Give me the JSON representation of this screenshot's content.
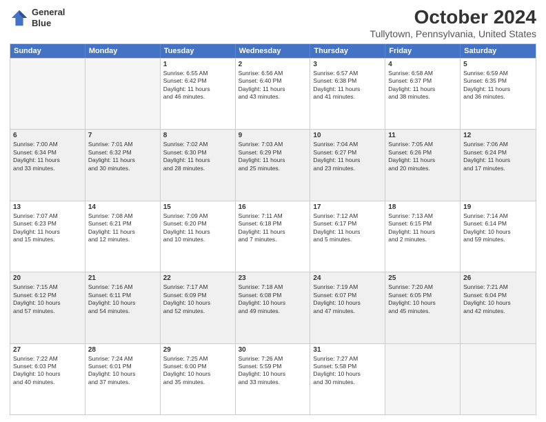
{
  "header": {
    "logo_line1": "General",
    "logo_line2": "Blue",
    "month": "October 2024",
    "location": "Tullytown, Pennsylvania, United States"
  },
  "weekdays": [
    "Sunday",
    "Monday",
    "Tuesday",
    "Wednesday",
    "Thursday",
    "Friday",
    "Saturday"
  ],
  "rows": [
    [
      {
        "day": "",
        "text": "",
        "empty": true
      },
      {
        "day": "",
        "text": "",
        "empty": true
      },
      {
        "day": "1",
        "text": "Sunrise: 6:55 AM\nSunset: 6:42 PM\nDaylight: 11 hours\nand 46 minutes."
      },
      {
        "day": "2",
        "text": "Sunrise: 6:56 AM\nSunset: 6:40 PM\nDaylight: 11 hours\nand 43 minutes."
      },
      {
        "day": "3",
        "text": "Sunrise: 6:57 AM\nSunset: 6:38 PM\nDaylight: 11 hours\nand 41 minutes."
      },
      {
        "day": "4",
        "text": "Sunrise: 6:58 AM\nSunset: 6:37 PM\nDaylight: 11 hours\nand 38 minutes."
      },
      {
        "day": "5",
        "text": "Sunrise: 6:59 AM\nSunset: 6:35 PM\nDaylight: 11 hours\nand 36 minutes."
      }
    ],
    [
      {
        "day": "6",
        "text": "Sunrise: 7:00 AM\nSunset: 6:34 PM\nDaylight: 11 hours\nand 33 minutes.",
        "shaded": true
      },
      {
        "day": "7",
        "text": "Sunrise: 7:01 AM\nSunset: 6:32 PM\nDaylight: 11 hours\nand 30 minutes.",
        "shaded": true
      },
      {
        "day": "8",
        "text": "Sunrise: 7:02 AM\nSunset: 6:30 PM\nDaylight: 11 hours\nand 28 minutes.",
        "shaded": true
      },
      {
        "day": "9",
        "text": "Sunrise: 7:03 AM\nSunset: 6:29 PM\nDaylight: 11 hours\nand 25 minutes.",
        "shaded": true
      },
      {
        "day": "10",
        "text": "Sunrise: 7:04 AM\nSunset: 6:27 PM\nDaylight: 11 hours\nand 23 minutes.",
        "shaded": true
      },
      {
        "day": "11",
        "text": "Sunrise: 7:05 AM\nSunset: 6:26 PM\nDaylight: 11 hours\nand 20 minutes.",
        "shaded": true
      },
      {
        "day": "12",
        "text": "Sunrise: 7:06 AM\nSunset: 6:24 PM\nDaylight: 11 hours\nand 17 minutes.",
        "shaded": true
      }
    ],
    [
      {
        "day": "13",
        "text": "Sunrise: 7:07 AM\nSunset: 6:23 PM\nDaylight: 11 hours\nand 15 minutes."
      },
      {
        "day": "14",
        "text": "Sunrise: 7:08 AM\nSunset: 6:21 PM\nDaylight: 11 hours\nand 12 minutes."
      },
      {
        "day": "15",
        "text": "Sunrise: 7:09 AM\nSunset: 6:20 PM\nDaylight: 11 hours\nand 10 minutes."
      },
      {
        "day": "16",
        "text": "Sunrise: 7:11 AM\nSunset: 6:18 PM\nDaylight: 11 hours\nand 7 minutes."
      },
      {
        "day": "17",
        "text": "Sunrise: 7:12 AM\nSunset: 6:17 PM\nDaylight: 11 hours\nand 5 minutes."
      },
      {
        "day": "18",
        "text": "Sunrise: 7:13 AM\nSunset: 6:15 PM\nDaylight: 11 hours\nand 2 minutes."
      },
      {
        "day": "19",
        "text": "Sunrise: 7:14 AM\nSunset: 6:14 PM\nDaylight: 10 hours\nand 59 minutes."
      }
    ],
    [
      {
        "day": "20",
        "text": "Sunrise: 7:15 AM\nSunset: 6:12 PM\nDaylight: 10 hours\nand 57 minutes.",
        "shaded": true
      },
      {
        "day": "21",
        "text": "Sunrise: 7:16 AM\nSunset: 6:11 PM\nDaylight: 10 hours\nand 54 minutes.",
        "shaded": true
      },
      {
        "day": "22",
        "text": "Sunrise: 7:17 AM\nSunset: 6:09 PM\nDaylight: 10 hours\nand 52 minutes.",
        "shaded": true
      },
      {
        "day": "23",
        "text": "Sunrise: 7:18 AM\nSunset: 6:08 PM\nDaylight: 10 hours\nand 49 minutes.",
        "shaded": true
      },
      {
        "day": "24",
        "text": "Sunrise: 7:19 AM\nSunset: 6:07 PM\nDaylight: 10 hours\nand 47 minutes.",
        "shaded": true
      },
      {
        "day": "25",
        "text": "Sunrise: 7:20 AM\nSunset: 6:05 PM\nDaylight: 10 hours\nand 45 minutes.",
        "shaded": true
      },
      {
        "day": "26",
        "text": "Sunrise: 7:21 AM\nSunset: 6:04 PM\nDaylight: 10 hours\nand 42 minutes.",
        "shaded": true
      }
    ],
    [
      {
        "day": "27",
        "text": "Sunrise: 7:22 AM\nSunset: 6:03 PM\nDaylight: 10 hours\nand 40 minutes."
      },
      {
        "day": "28",
        "text": "Sunrise: 7:24 AM\nSunset: 6:01 PM\nDaylight: 10 hours\nand 37 minutes."
      },
      {
        "day": "29",
        "text": "Sunrise: 7:25 AM\nSunset: 6:00 PM\nDaylight: 10 hours\nand 35 minutes."
      },
      {
        "day": "30",
        "text": "Sunrise: 7:26 AM\nSunset: 5:59 PM\nDaylight: 10 hours\nand 33 minutes."
      },
      {
        "day": "31",
        "text": "Sunrise: 7:27 AM\nSunset: 5:58 PM\nDaylight: 10 hours\nand 30 minutes."
      },
      {
        "day": "",
        "text": "",
        "empty": true
      },
      {
        "day": "",
        "text": "",
        "empty": true
      }
    ]
  ]
}
